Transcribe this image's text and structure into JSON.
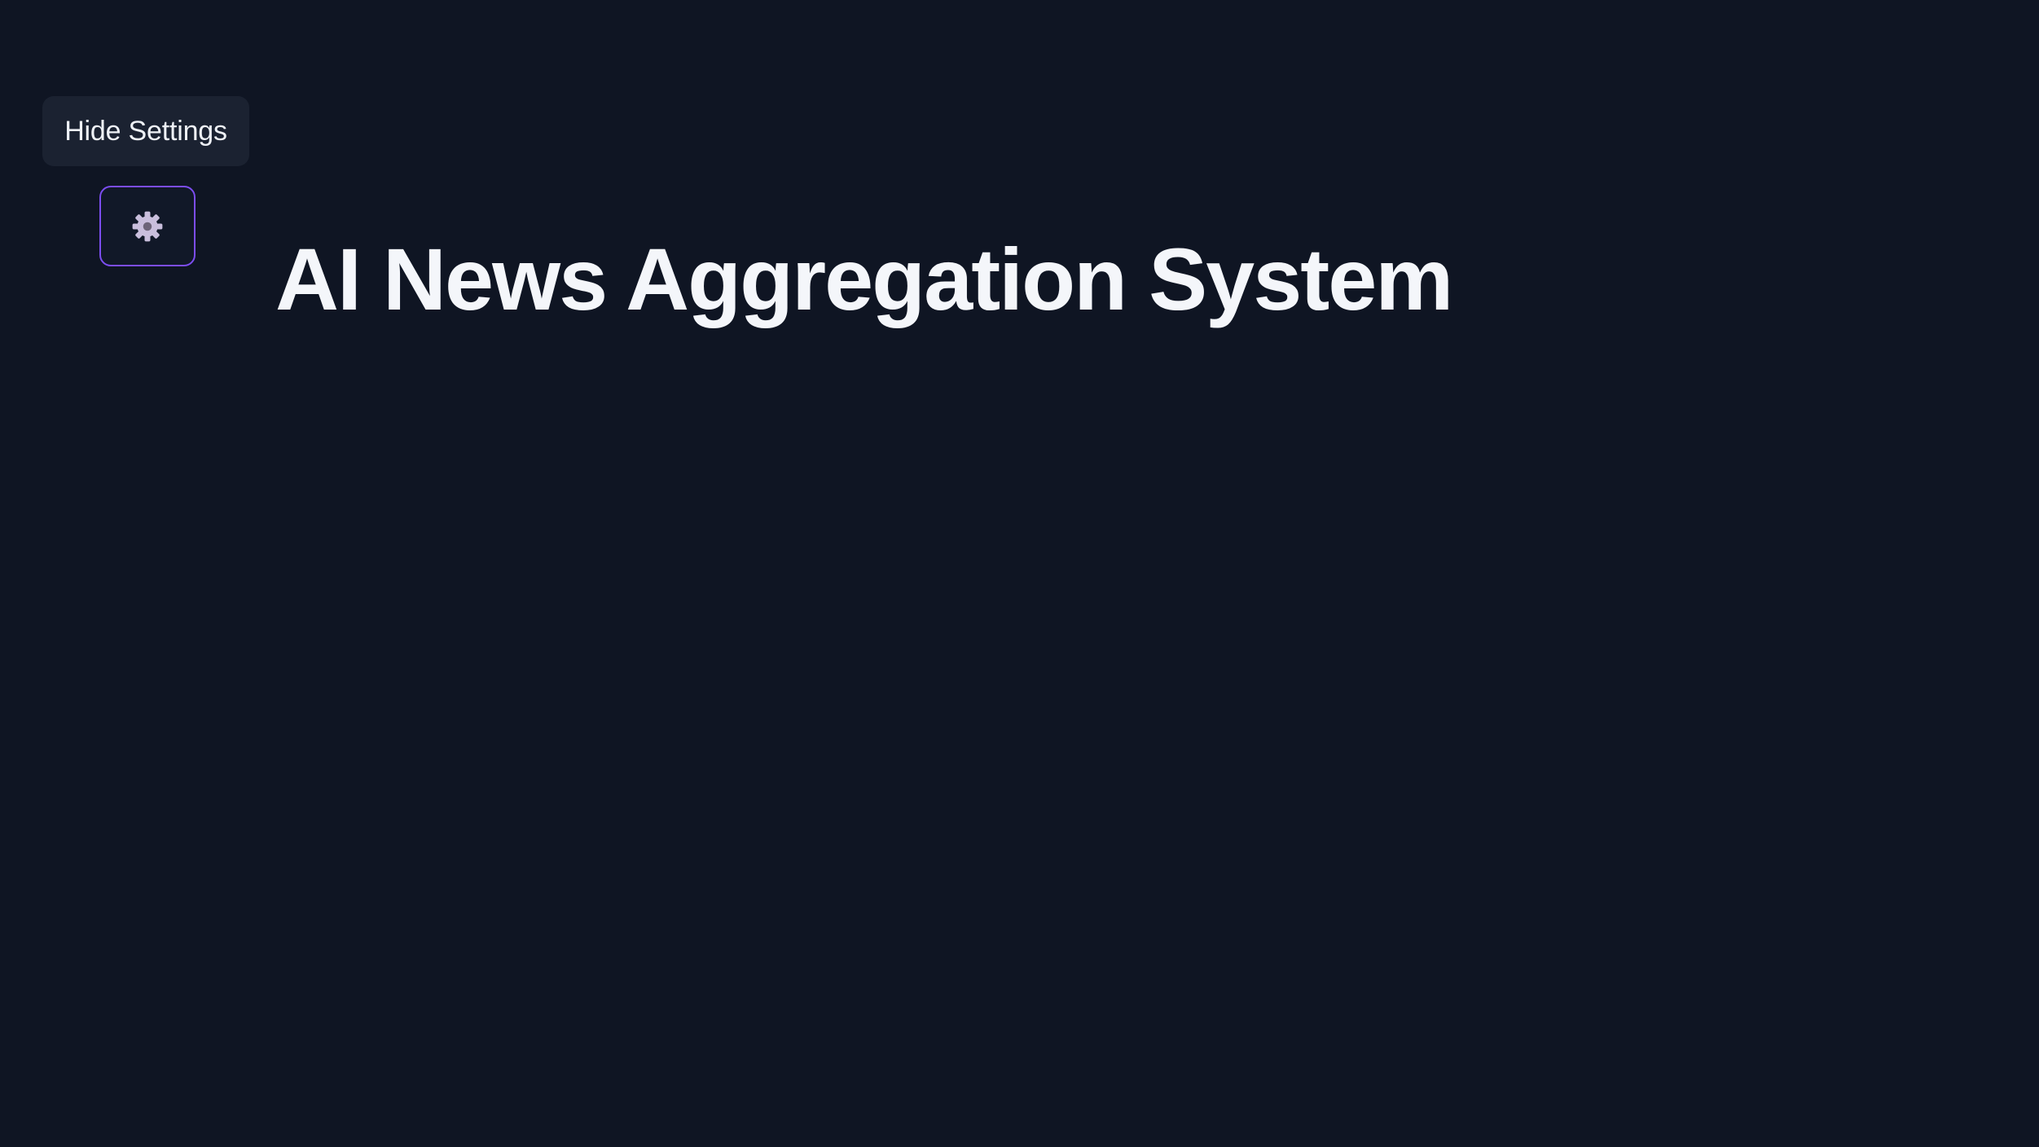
{
  "settings_toggle": {
    "tooltip_label": "Hide Settings",
    "icon": "gear-icon",
    "accent_color": "#7c4df0"
  },
  "header": {
    "title": "AI News Aggregation System"
  },
  "colors": {
    "background": "#0f1523",
    "tooltip_background": "#1b2231",
    "text": "#f4f6fa",
    "icon": "#c9bedc"
  }
}
